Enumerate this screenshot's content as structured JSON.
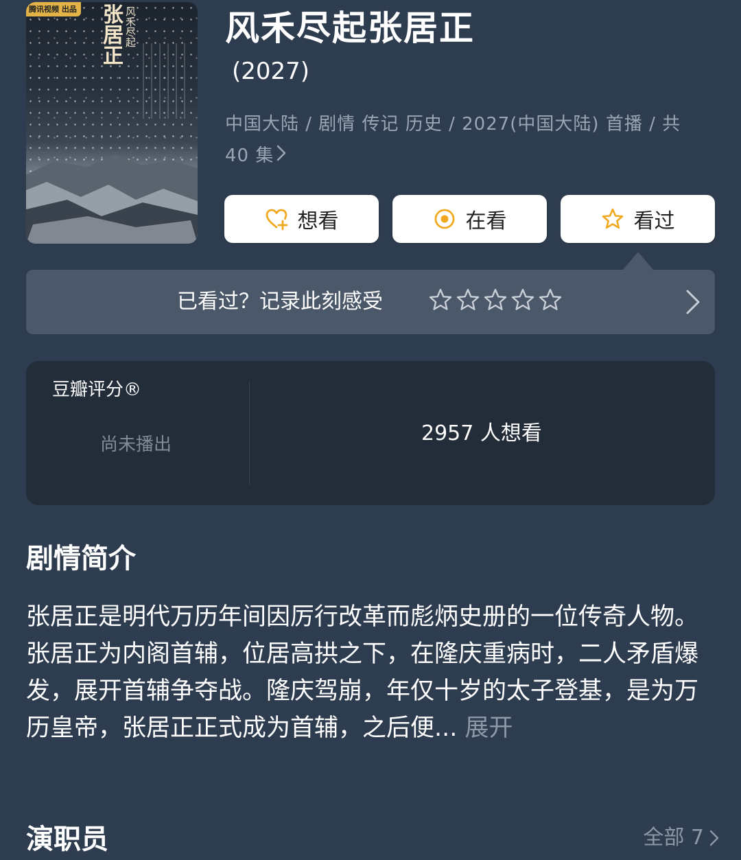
{
  "poster": {
    "producer_tag": "腾讯视频 出品",
    "title_text": "张居正",
    "sub_text": "风禾尽起"
  },
  "header": {
    "title": "风禾尽起张居正",
    "year": "(2027)",
    "meta": "中国大陆 / 剧情 传记 历史 / 2027(中国大陆) 首播 / 共 40 集"
  },
  "actions": {
    "want_label": "想看",
    "doing_label": "在看",
    "done_label": "看过"
  },
  "rating_prompt": {
    "text": "已看过？记录此刻感受",
    "stars": 5,
    "rating": 0
  },
  "score": {
    "label": "豆瓣评分®",
    "status": "尚未播出",
    "want_count": "2957 人想看"
  },
  "synopsis": {
    "title": "剧情简介",
    "text": "张居正是明代万历年间因厉行改革而彪炳史册的一位传奇人物。张居正为内阁首辅，位居高拱之下，在隆庆重病时，二人矛盾爆发，展开首辅争夺战。隆庆驾崩，年仅十岁的太子登基，是为万历皇帝，张居正正式成为首辅，之后便...",
    "expand_label": "展开"
  },
  "cast": {
    "title": "演职员",
    "all_label": "全部 7"
  },
  "colors": {
    "background": "#2e3c4f",
    "panel": "#232c39",
    "rate_bar": "#4b5869",
    "accent": "#f0a81e"
  },
  "icons": {
    "want": "heart-plus-icon",
    "doing": "target-circle-icon",
    "done": "star-outline-icon"
  }
}
